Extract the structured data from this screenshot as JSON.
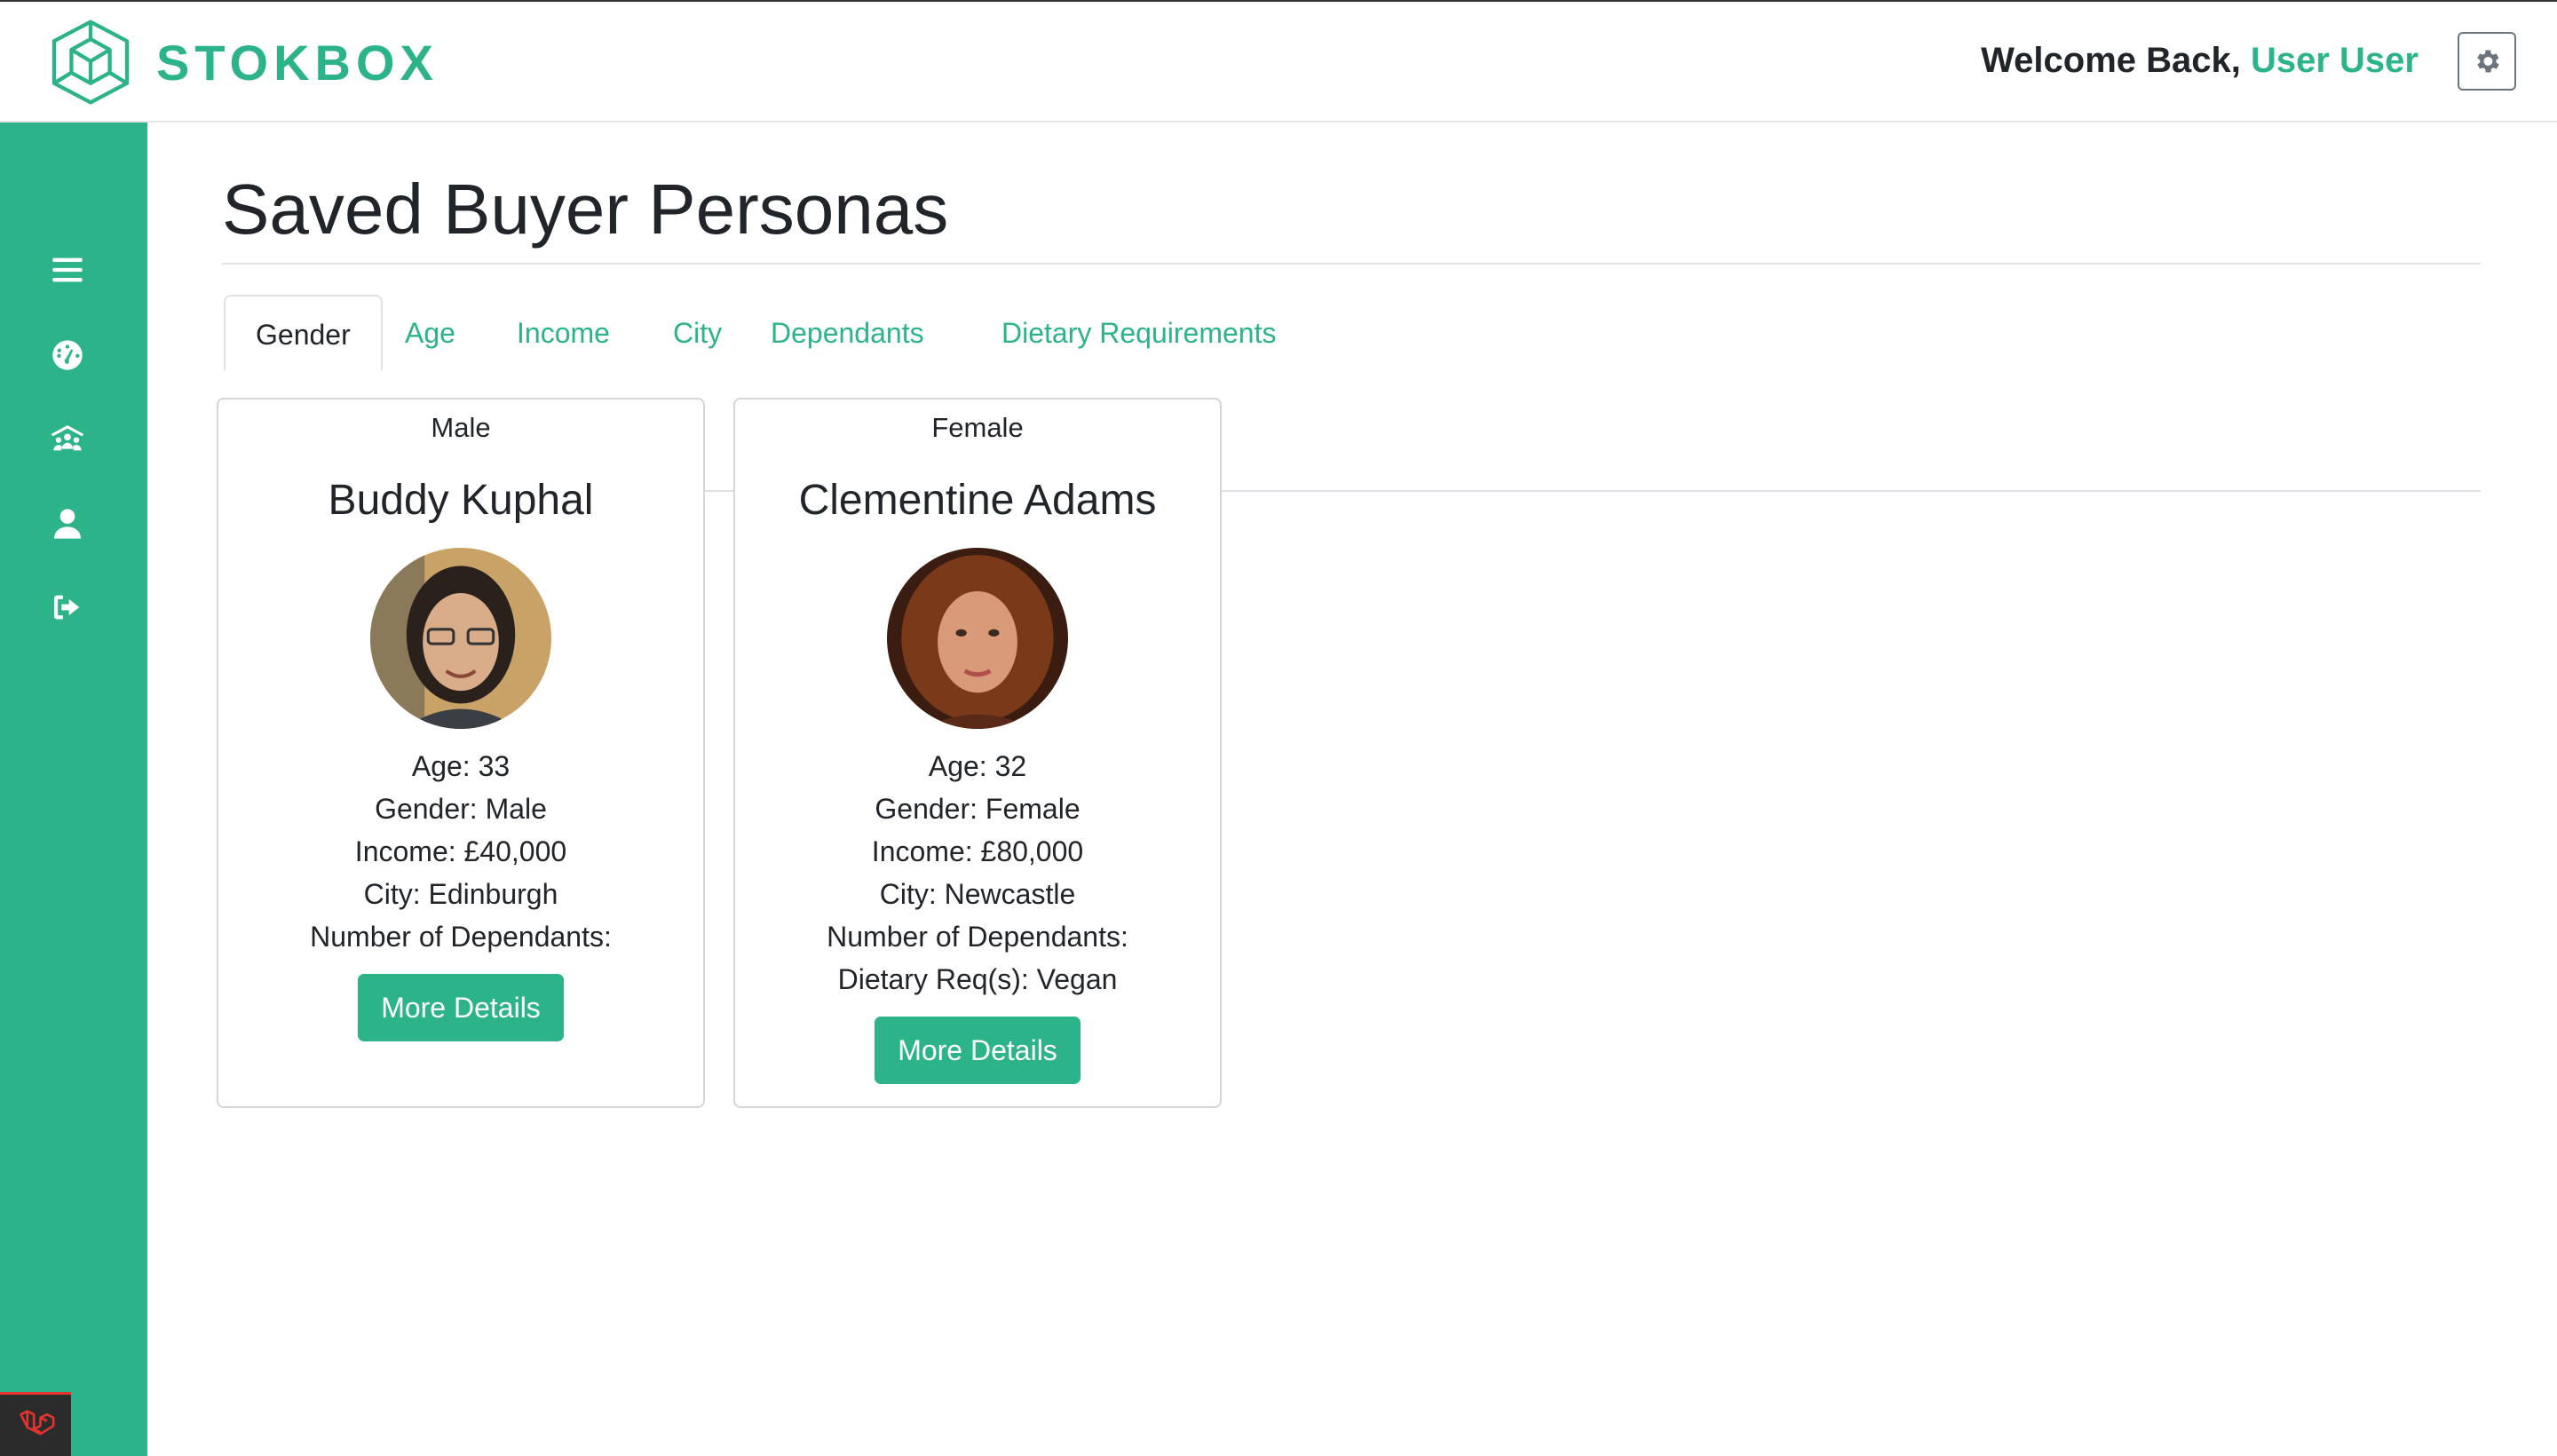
{
  "app": {
    "brand": "STOKBOX",
    "accent": "#2db38a"
  },
  "header": {
    "welcome_prefix": "Welcome Back, ",
    "user_name": "User User"
  },
  "page": {
    "title": "Saved Buyer Personas"
  },
  "tabs": [
    {
      "label": "Gender",
      "active": true
    },
    {
      "label": "Age"
    },
    {
      "label": "Income"
    },
    {
      "label": "City"
    },
    {
      "label": "Dependants"
    },
    {
      "label": "Dietary Requirements"
    }
  ],
  "sidebar": {
    "icons": [
      "menu-icon",
      "dashboard-icon",
      "group-icon",
      "user-icon",
      "logout-icon"
    ]
  },
  "personas": [
    {
      "category": "Male",
      "name": "Buddy Kuphal",
      "age": "Age: 33",
      "gender": "Gender: Male",
      "income": "Income: £40,000",
      "city": "City: Edinburgh",
      "dependants": "Number of Dependants:",
      "dietary": "",
      "button": "More Details"
    },
    {
      "category": "Female",
      "name": "Clementine Adams",
      "age": "Age: 32",
      "gender": "Gender: Female",
      "income": "Income: £80,000",
      "city": "City: Newcastle",
      "dependants": "Number of Dependants:",
      "dietary": "Dietary Req(s): Vegan",
      "button": "More Details"
    }
  ]
}
